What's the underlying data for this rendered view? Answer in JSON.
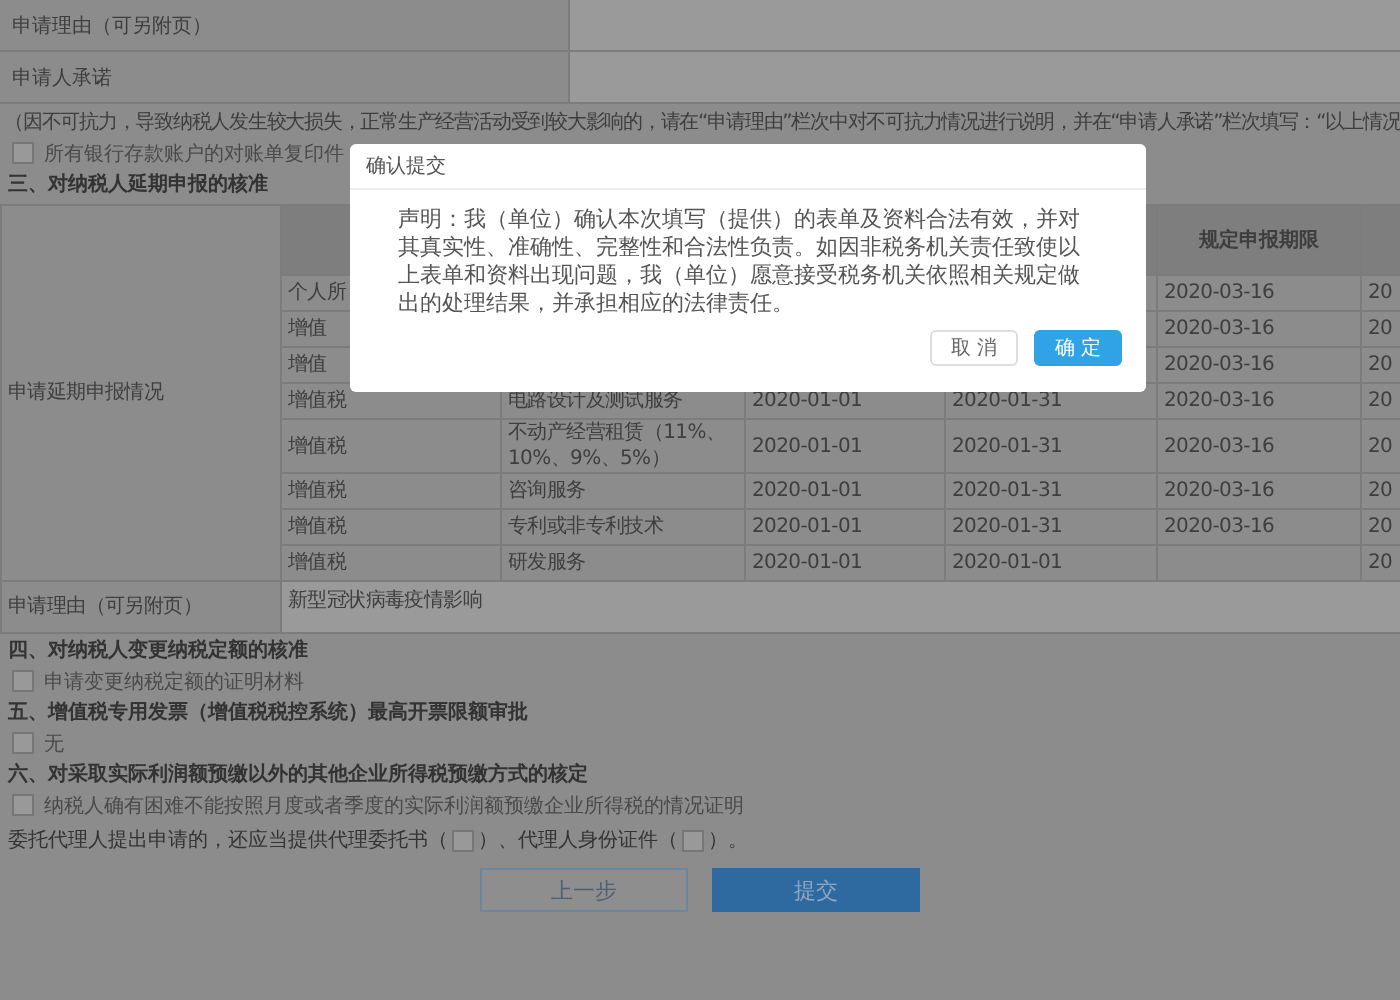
{
  "form": {
    "top_rows": [
      {
        "label": "申请理由（可另附页）"
      },
      {
        "label": "申请人承诺"
      }
    ],
    "force_majeure_note": "（因不可抗力，导致纳税人发生较大损失，正常生产经营活动受到较大影响的，请在“申请理由”栏次中对不可抗力情况进行说明，并在“申请人承诺”栏次填写：“以上情况",
    "bank_statement": {
      "label": "所有银行存款账户的对账单复印件",
      "checked": false
    },
    "section_3": {
      "title": "三、对纳税人延期申报的核准",
      "table": {
        "row_label": "申请延期申报情况",
        "deadline_header": "规定申报期限",
        "rows": [
          {
            "type": "个人所",
            "deadline": "2020-03-16",
            "column_6": "20"
          },
          {
            "type": "增值",
            "deadline": "2020-03-16",
            "column_6": "20"
          },
          {
            "type": "增值",
            "deadline": "2020-03-16",
            "column_6": "20"
          },
          {
            "type": "增值税",
            "item": "电路设计及测试服务",
            "start": "2020-01-01",
            "end": "2020-01-31",
            "deadline": "2020-03-16",
            "column_6": "20"
          },
          {
            "type": "增值税",
            "item": "不动产经营租赁（11%、10%、9%、5%）",
            "start": "2020-01-01",
            "end": "2020-01-31",
            "deadline": "2020-03-16",
            "column_6": "20"
          },
          {
            "type": "增值税",
            "item": "咨询服务",
            "start": "2020-01-01",
            "end": "2020-01-31",
            "deadline": "2020-03-16",
            "column_6": "20"
          },
          {
            "type": "增值税",
            "item": "专利或非专利技术",
            "start": "2020-01-01",
            "end": "2020-01-31",
            "deadline": "2020-03-16",
            "column_6": "20"
          },
          {
            "type": "增值税",
            "item": "研发服务",
            "start": "2020-01-01",
            "end": "2020-01-01",
            "column_6": "20"
          }
        ],
        "reason_label": "申请理由（可另附页）",
        "reason_value": "新型冠状病毒疫情影响"
      }
    },
    "section_4": {
      "title": "四、对纳税人变更纳税定额的核准",
      "options": [
        {
          "label": "申请变更纳税定额的证明材料",
          "checked": false
        }
      ]
    },
    "section_5": {
      "title": "五、增值税专用发票（增值税税控系统）最高开票限额审批",
      "options": [
        {
          "label": "无",
          "checked": false
        }
      ]
    },
    "section_6": {
      "title": "六、对采取实际利润额预缴以外的其他企业所得税预缴方式的核定",
      "options": [
        {
          "label": "纳税人确有困难不能按照月度或者季度的实际利润额预缴企业所得税的情况证明",
          "checked": false
        }
      ]
    },
    "agent_line": [
      {
        "kind": "text",
        "text": "委托代理人提出申请的，还应当提供代理委托书（"
      },
      {
        "kind": "checkbox",
        "checked": false
      },
      {
        "kind": "text",
        "text": "）、代理人身份证件（"
      },
      {
        "kind": "checkbox",
        "checked": false
      },
      {
        "kind": "text",
        "text": "）。"
      }
    ],
    "buttons": [
      {
        "label": "上一步",
        "kind": "secondary"
      },
      {
        "label": "提交",
        "kind": "primary"
      }
    ]
  },
  "dialog": {
    "title": "确认提交",
    "message": "声明：我（单位）确认本次填写（提供）的表单及资料合法有效，并对其真实性、准确性、完整性和合法性负责。如因非税务机关责任致使以上表单和资料出现问题，我（单位）愿意接受税务机关依照相关规定做出的处理结果，并承担相应的法律责任。",
    "buttons": [
      {
        "label": "取 消",
        "kind": "secondary"
      },
      {
        "label": "确 定",
        "kind": "primary"
      }
    ]
  }
}
